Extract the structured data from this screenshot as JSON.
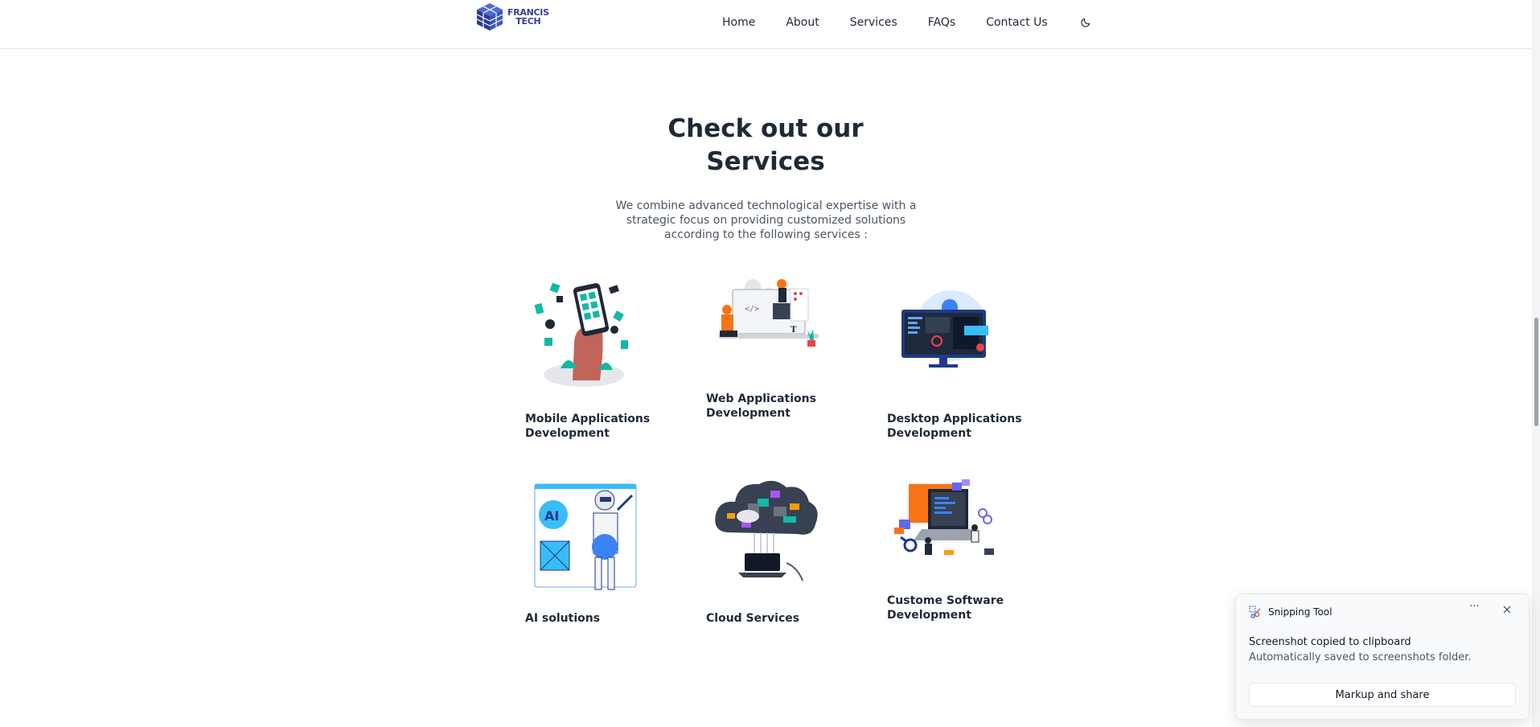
{
  "header": {
    "logo_line1": "FRANCIS",
    "logo_line2": "TECH",
    "nav": [
      "Home",
      "About",
      "Services",
      "FAQs",
      "Contact Us"
    ]
  },
  "main": {
    "title_line1": "Check out our",
    "title_line2": "Services",
    "description_lines": [
      "We combine advanced technological expertise with a",
      "strategic focus on providing customized solutions",
      "according to the following services :"
    ],
    "services": [
      {
        "line1": "Mobile Applications",
        "line2": "Development"
      },
      {
        "line1": "Web Applications",
        "line2": "Development"
      },
      {
        "line1": "Desktop Applications",
        "line2": "Development"
      },
      {
        "line1": "AI solutions",
        "line2": ""
      },
      {
        "line1": "Cloud Services",
        "line2": ""
      },
      {
        "line1": "Custome Software",
        "line2": "Development"
      }
    ]
  },
  "toast": {
    "app_name": "Snipping Tool",
    "more_glyph": "···",
    "headline": "Screenshot copied to clipboard",
    "subtext": "Automatically saved to screenshots folder.",
    "button_label": "Markup and share"
  },
  "colors": {
    "brand": "#3b3f8f",
    "accent_teal": "#14b8a6",
    "text": "#1f2937"
  }
}
